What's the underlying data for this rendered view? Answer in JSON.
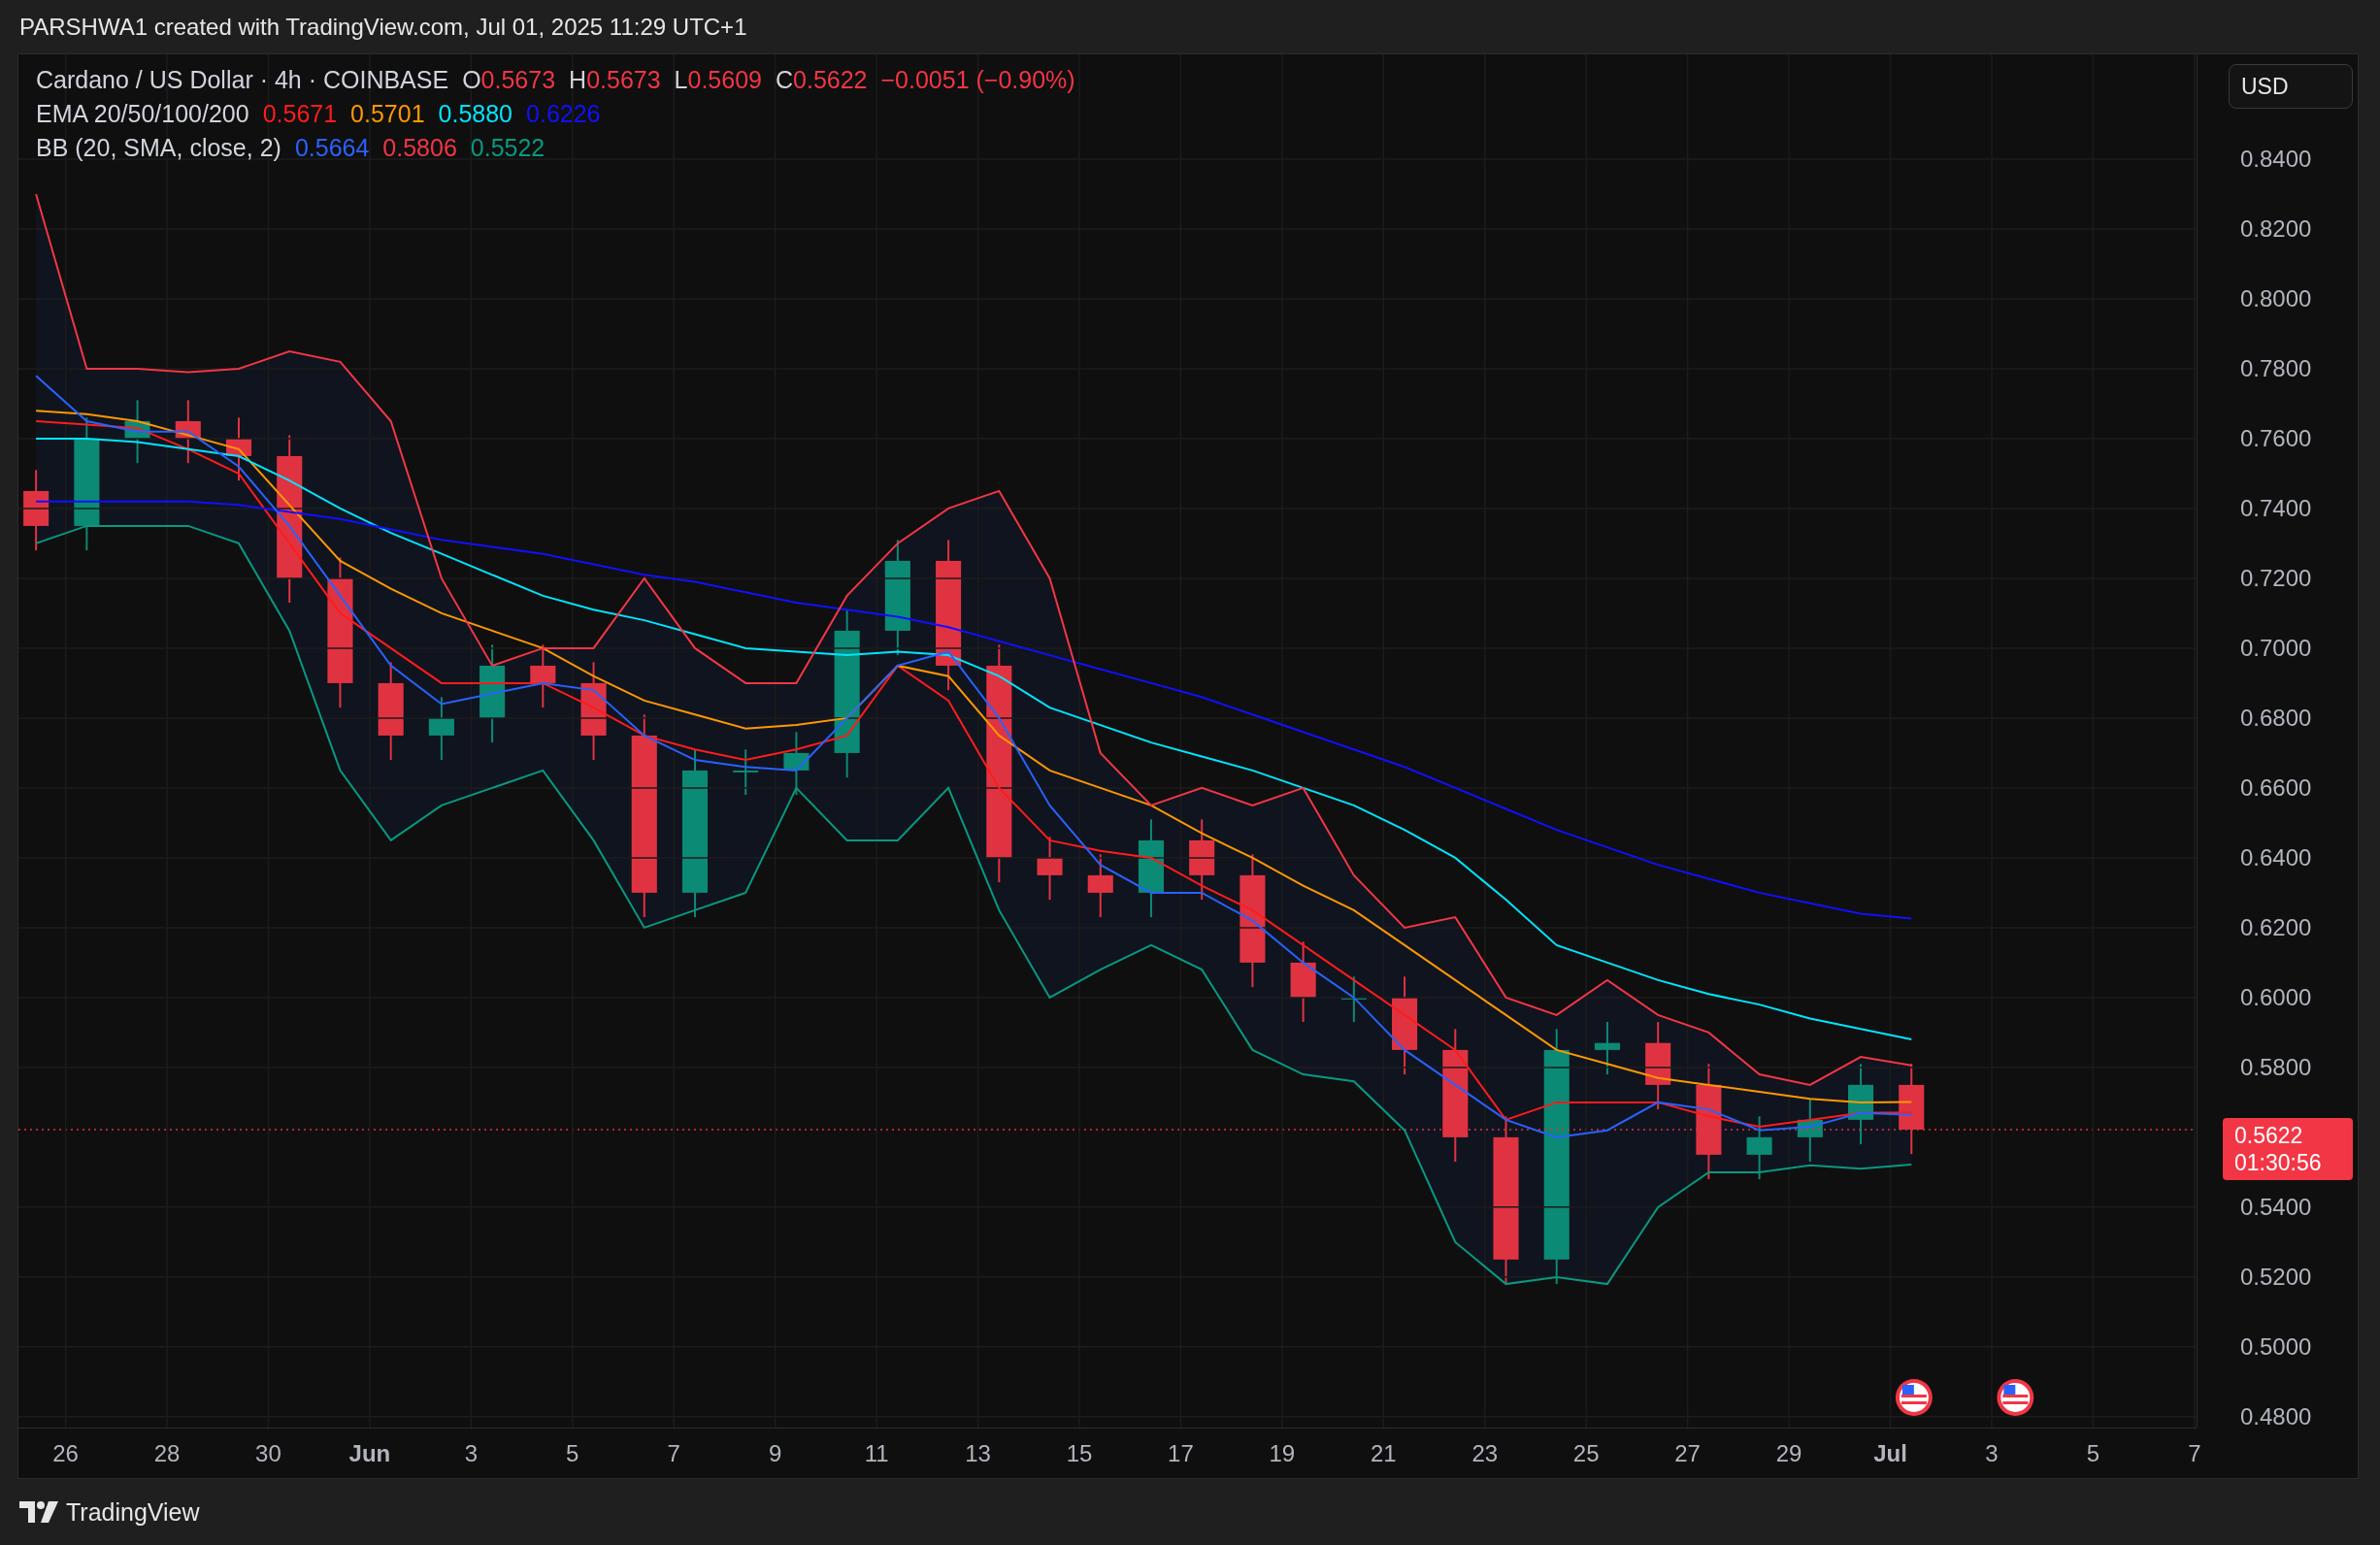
{
  "header": {
    "text": "PARSHWA1 created with TradingView.com, Jul 01, 2025 11:29 UTC+1"
  },
  "legend": {
    "symbol": "Cardano / US Dollar · 4h · COINBASE",
    "ohlc": [
      {
        "label": "O",
        "value": "0.5673"
      },
      {
        "label": "H",
        "value": "0.5673"
      },
      {
        "label": "L",
        "value": "0.5609"
      },
      {
        "label": "C",
        "value": "0.5622"
      }
    ],
    "change": "−0.0051 (−0.90%)",
    "indicators": [
      {
        "label": "EMA 20/50/100/200",
        "values": [
          {
            "text": "0.5671",
            "color": "#ff1c1c"
          },
          {
            "text": "0.5701",
            "color": "#ff9800"
          },
          {
            "text": "0.5880",
            "color": "#00e5ff"
          },
          {
            "text": "0.6226",
            "color": "#1010ff"
          }
        ]
      },
      {
        "label": "BB (20, SMA, close, 2)",
        "values": [
          {
            "text": "0.5664",
            "color": "#2962ff"
          },
          {
            "text": "0.5806",
            "color": "#f23645"
          },
          {
            "text": "0.5522",
            "color": "#089981"
          }
        ]
      }
    ]
  },
  "currency_button": "USD",
  "price_axis": {
    "last_price": "0.5622",
    "countdown": "01:30:56"
  },
  "chart_data": {
    "type": "line",
    "x": [
      "2025-05-25T10:00",
      "2025-05-26T10:00",
      "2025-05-27T10:00",
      "2025-05-28T10:00",
      "2025-05-29T10:00",
      "2025-05-30T10:00",
      "2025-05-31T10:00",
      "2025-06-01T10:00",
      "2025-06-02T10:00",
      "2025-06-03T10:00",
      "2025-06-04T10:00",
      "2025-06-05T10:00",
      "2025-06-06T10:00",
      "2025-06-07T10:00",
      "2025-06-08T10:00",
      "2025-06-09T10:00",
      "2025-06-10T10:00",
      "2025-06-11T10:00",
      "2025-06-12T10:00",
      "2025-06-13T10:00",
      "2025-06-14T10:00",
      "2025-06-15T10:00",
      "2025-06-16T10:00",
      "2025-06-17T10:00",
      "2025-06-18T10:00",
      "2025-06-19T10:00",
      "2025-06-20T10:00",
      "2025-06-21T10:00",
      "2025-06-22T10:00",
      "2025-06-23T10:00",
      "2025-06-24T10:00",
      "2025-06-25T10:00",
      "2025-06-26T10:00",
      "2025-06-27T10:00",
      "2025-06-28T10:00",
      "2025-06-29T10:00",
      "2025-06-30T10:00",
      "2025-07-01T10:00"
    ],
    "series": [
      {
        "color": "#ff1c1c",
        "values": [
          0.765,
          0.764,
          0.763,
          0.757,
          0.75,
          0.73,
          0.71,
          0.7,
          0.69,
          0.69,
          0.69,
          0.683,
          0.675,
          0.671,
          0.668,
          0.671,
          0.675,
          0.695,
          0.685,
          0.66,
          0.645,
          0.642,
          0.64,
          0.632,
          0.625,
          0.615,
          0.605,
          0.595,
          0.585,
          0.565,
          0.57,
          0.57,
          0.57,
          0.566,
          0.563,
          0.565,
          0.567,
          0.5671
        ]
      },
      {
        "color": "#ff9800",
        "values": [
          0.768,
          0.767,
          0.765,
          0.761,
          0.757,
          0.741,
          0.725,
          0.717,
          0.71,
          0.705,
          0.7,
          0.692,
          0.685,
          0.681,
          0.677,
          0.678,
          0.68,
          0.695,
          0.692,
          0.675,
          0.665,
          0.66,
          0.655,
          0.647,
          0.64,
          0.632,
          0.625,
          0.615,
          0.605,
          0.595,
          0.585,
          0.581,
          0.577,
          0.575,
          0.573,
          0.571,
          0.57,
          0.5701
        ]
      },
      {
        "color": "#00e5ff",
        "values": [
          0.76,
          0.76,
          0.759,
          0.757,
          0.755,
          0.748,
          0.74,
          0.733,
          0.727,
          0.721,
          0.715,
          0.711,
          0.708,
          0.704,
          0.7,
          0.699,
          0.698,
          0.699,
          0.698,
          0.692,
          0.683,
          0.678,
          0.673,
          0.669,
          0.665,
          0.66,
          0.655,
          0.648,
          0.64,
          0.628,
          0.615,
          0.61,
          0.605,
          0.601,
          0.598,
          0.594,
          0.591,
          0.588
        ]
      },
      {
        "color": "#1010ff",
        "values": [
          0.742,
          0.742,
          0.742,
          0.742,
          0.741,
          0.739,
          0.737,
          0.734,
          0.731,
          0.729,
          0.727,
          0.724,
          0.721,
          0.719,
          0.716,
          0.713,
          0.711,
          0.709,
          0.706,
          0.702,
          0.698,
          0.694,
          0.69,
          0.686,
          0.681,
          0.676,
          0.671,
          0.666,
          0.66,
          0.654,
          0.648,
          0.643,
          0.638,
          0.634,
          0.63,
          0.627,
          0.624,
          0.6226
        ]
      },
      {
        "color": "#2962ff",
        "values": [
          0.778,
          0.765,
          0.762,
          0.762,
          0.752,
          0.735,
          0.715,
          0.695,
          0.684,
          0.687,
          0.69,
          0.688,
          0.675,
          0.668,
          0.666,
          0.665,
          0.68,
          0.695,
          0.699,
          0.68,
          0.655,
          0.638,
          0.63,
          0.63,
          0.622,
          0.61,
          0.6,
          0.585,
          0.575,
          0.565,
          0.56,
          0.562,
          0.57,
          0.568,
          0.562,
          0.563,
          0.567,
          0.5664
        ]
      },
      {
        "color": "#f23645",
        "values": [
          0.83,
          0.78,
          0.78,
          0.779,
          0.78,
          0.785,
          0.782,
          0.765,
          0.72,
          0.695,
          0.7,
          0.7,
          0.72,
          0.7,
          0.69,
          0.69,
          0.715,
          0.73,
          0.74,
          0.745,
          0.72,
          0.67,
          0.655,
          0.66,
          0.655,
          0.66,
          0.635,
          0.62,
          0.623,
          0.6,
          0.595,
          0.605,
          0.595,
          0.59,
          0.578,
          0.575,
          0.583,
          0.5806
        ]
      },
      {
        "color": "#089981",
        "values": [
          0.73,
          0.735,
          0.735,
          0.735,
          0.73,
          0.705,
          0.665,
          0.645,
          0.655,
          0.66,
          0.665,
          0.645,
          0.62,
          0.625,
          0.63,
          0.66,
          0.645,
          0.645,
          0.66,
          0.625,
          0.6,
          0.608,
          0.615,
          0.608,
          0.585,
          0.578,
          0.576,
          0.562,
          0.53,
          0.518,
          0.52,
          0.518,
          0.54,
          0.55,
          0.55,
          0.552,
          0.551,
          0.5522
        ]
      }
    ],
    "xlim": [
      "2025-05-25T01:40",
      "2025-07-07T01:00"
    ],
    "ylim": [
      0.4769,
      0.87
    ],
    "grid": true,
    "xticks": [
      {
        "value": "2025-05-26",
        "label": "26"
      },
      {
        "value": "2025-05-28",
        "label": "28"
      },
      {
        "value": "2025-05-30",
        "label": "30"
      },
      {
        "value": "2025-06-01",
        "label": "Jun"
      },
      {
        "value": "2025-06-03",
        "label": "3"
      },
      {
        "value": "2025-06-05",
        "label": "5"
      },
      {
        "value": "2025-06-07",
        "label": "7"
      },
      {
        "value": "2025-06-09",
        "label": "9"
      },
      {
        "value": "2025-06-11",
        "label": "11"
      },
      {
        "value": "2025-06-13",
        "label": "13"
      },
      {
        "value": "2025-06-15",
        "label": "15"
      },
      {
        "value": "2025-06-17",
        "label": "17"
      },
      {
        "value": "2025-06-19",
        "label": "19"
      },
      {
        "value": "2025-06-21",
        "label": "21"
      },
      {
        "value": "2025-06-23",
        "label": "23"
      },
      {
        "value": "2025-06-25",
        "label": "25"
      },
      {
        "value": "2025-06-27",
        "label": "27"
      },
      {
        "value": "2025-06-29",
        "label": "29"
      },
      {
        "value": "2025-07-01",
        "label": "Jul"
      },
      {
        "value": "2025-07-03",
        "label": "3"
      },
      {
        "value": "2025-07-05",
        "label": "5"
      },
      {
        "value": "2025-07-07",
        "label": "7"
      }
    ],
    "yticks": [
      {
        "value": 0.84,
        "label": "0.8400"
      },
      {
        "value": 0.82,
        "label": "0.8200"
      },
      {
        "value": 0.8,
        "label": "0.8000"
      },
      {
        "value": 0.78,
        "label": "0.7800"
      },
      {
        "value": 0.76,
        "label": "0.7600"
      },
      {
        "value": 0.74,
        "label": "0.7400"
      },
      {
        "value": 0.72,
        "label": "0.7200"
      },
      {
        "value": 0.7,
        "label": "0.7000"
      },
      {
        "value": 0.68,
        "label": "0.6800"
      },
      {
        "value": 0.66,
        "label": "0.6600"
      },
      {
        "value": 0.64,
        "label": "0.6400"
      },
      {
        "value": 0.62,
        "label": "0.6200"
      },
      {
        "value": 0.6,
        "label": "0.6000"
      },
      {
        "value": 0.58,
        "label": "0.5800"
      },
      {
        "value": 0.54,
        "label": "0.5400"
      },
      {
        "value": 0.52,
        "label": "0.5200"
      },
      {
        "value": 0.5,
        "label": "0.5000"
      },
      {
        "value": 0.48,
        "label": "0.4800"
      }
    ]
  },
  "footer": {
    "logo_text": "TradingView"
  }
}
